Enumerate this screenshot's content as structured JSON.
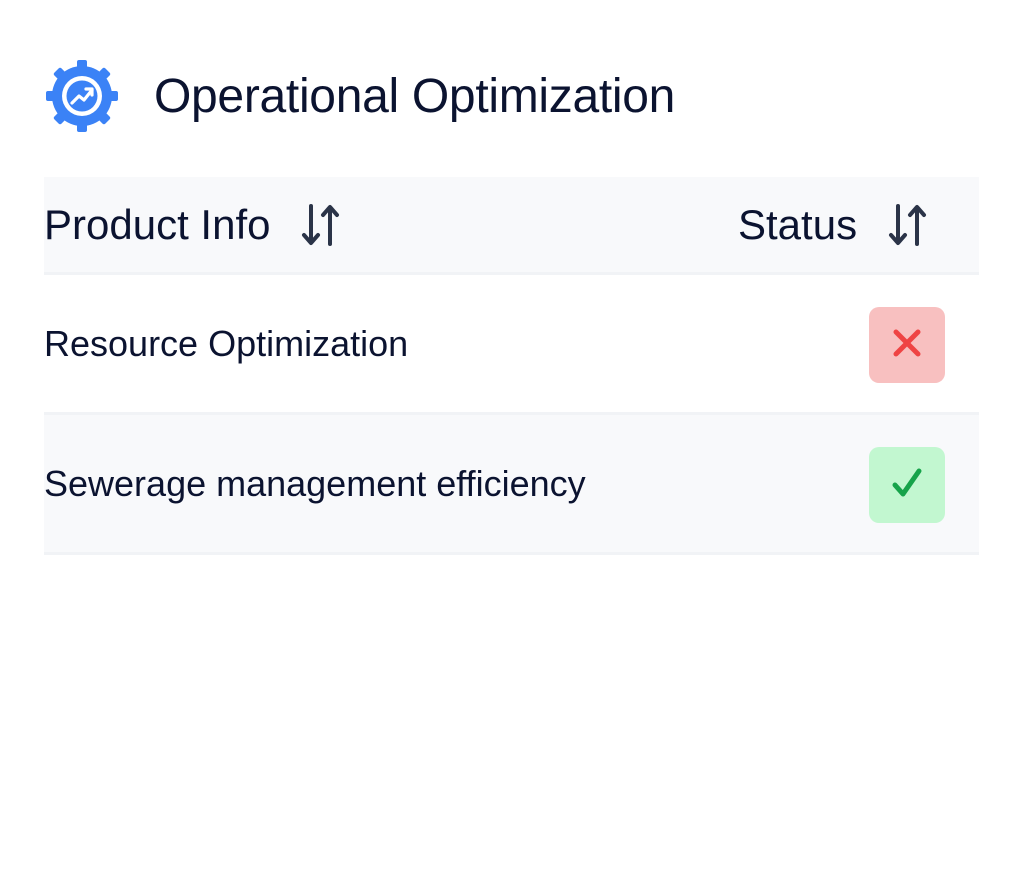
{
  "header": {
    "title": "Operational Optimization",
    "icon": "gear-growth-icon",
    "icon_color": "#3b82f6"
  },
  "table": {
    "columns": [
      {
        "label": "Product Info",
        "sort_icon": "sort-arrows-icon"
      },
      {
        "label": "Status",
        "sort_icon": "sort-arrows-icon"
      }
    ],
    "rows": [
      {
        "name": "Resource Optimization",
        "status": "fail",
        "status_icon": "x-icon",
        "status_color": "#ef4444",
        "badge_color": "#f8c0c0"
      },
      {
        "name": "Sewerage management efficiency",
        "status": "pass",
        "status_icon": "check-icon",
        "status_color": "#16a34a",
        "badge_color": "#c2f7d0"
      }
    ]
  }
}
